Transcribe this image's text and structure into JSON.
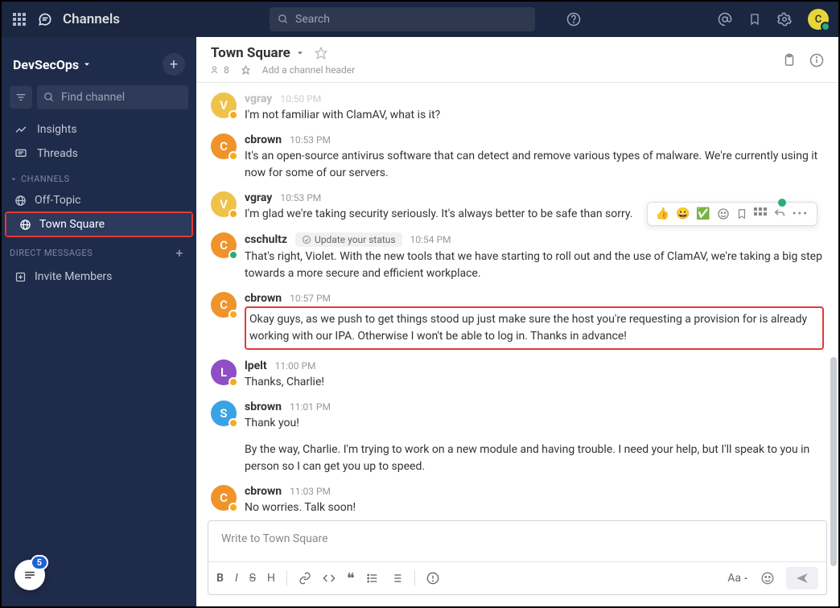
{
  "topbar": {
    "title": "Channels",
    "search_placeholder": "Search"
  },
  "team": {
    "name": "DevSecOps",
    "find_placeholder": "Find channel"
  },
  "nav": {
    "insights": "Insights",
    "threads": "Threads"
  },
  "sections": {
    "channels_label": "CHANNELS",
    "dm_label": "DIRECT MESSAGES"
  },
  "channels": [
    {
      "name": "Off-Topic"
    },
    {
      "name": "Town Square"
    }
  ],
  "invite_label": "Invite Members",
  "badge_count": "5",
  "header": {
    "channel_name": "Town Square",
    "member_count": "8",
    "add_header": "Add a channel header"
  },
  "messages": [
    {
      "user": "vgray",
      "time": "10:50 PM",
      "text": "I'm not familiar with ClamAV, what is it?",
      "color": "#efc24a",
      "initial": "V",
      "status": "orange",
      "faded": true
    },
    {
      "user": "cbrown",
      "time": "10:53 PM",
      "text": "It's an open-source antivirus software that can detect and remove various types of malware.  We're currently using it now for some of our servers.",
      "color": "#f0932b",
      "initial": "C",
      "status": "orange"
    },
    {
      "user": "vgray",
      "time": "10:53 PM",
      "text": "I'm glad we're taking security seriously. It's always better to be safe than sorry.",
      "color": "#efc24a",
      "initial": "V",
      "status": "orange"
    },
    {
      "user": "cschultz",
      "time": "10:54 PM",
      "text": "That's right, Violet. With the new tools that we have starting to roll out and the use of ClamAV, we're taking a big step towards a more secure and efficient workplace.",
      "color": "#f0932b",
      "initial": "C",
      "status": "green",
      "pill": "Update your status"
    },
    {
      "user": "cbrown",
      "time": "10:57 PM",
      "text": "Okay guys, as we push to get things stood up just make sure the host you're requesting a provision for is already working with our IPA.  Otherwise I won't be able to log in.  Thanks in advance!",
      "color": "#f0932b",
      "initial": "C",
      "status": "orange",
      "highlight": true
    },
    {
      "user": "lpelt",
      "time": "11:00 PM",
      "text": "Thanks, Charlie!",
      "color": "#8e4ec6",
      "initial": "L",
      "status": "orange"
    },
    {
      "user": "sbrown",
      "time": "11:01 PM",
      "text": "Thank you!",
      "text2": "By the way, Charlie.  I'm trying to work on a new module and having trouble.  I need your help, but I'll speak to you in person so I can get you up to speed.",
      "color": "#3aa3e3",
      "initial": "S",
      "status": "orange"
    },
    {
      "user": "cbrown",
      "time": "11:03 PM",
      "text": "No worries.  Talk soon!",
      "color": "#f0932b",
      "initial": "C",
      "status": "orange"
    }
  ],
  "compose": {
    "placeholder": "Write to Town Square",
    "font_label": "Aa"
  },
  "avatar_initial": "C"
}
